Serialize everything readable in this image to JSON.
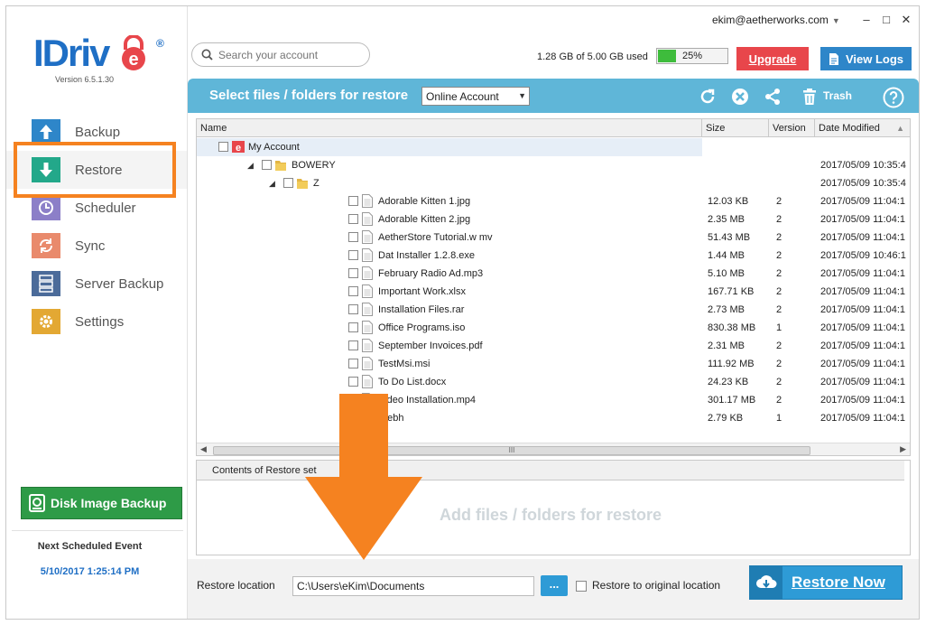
{
  "app": {
    "logo_text": "IDriv",
    "logo_mark": "e",
    "logo_reg": "®",
    "version": "Version  6.5.1.30"
  },
  "titlebar": {
    "account": "ekim@aetherworks.com",
    "minimize": "–",
    "maximize": "□",
    "close": "✕"
  },
  "search": {
    "placeholder": "Search your account"
  },
  "storage": {
    "usage_text": "1.28 GB of 5.00 GB used",
    "percent_text": "25%",
    "percent": 25
  },
  "header_buttons": {
    "upgrade": "Upgrade",
    "view_logs": "View Logs"
  },
  "sidebar": {
    "items": [
      {
        "label": "Backup",
        "color": "#2e86c9"
      },
      {
        "label": "Restore",
        "color": "#23a88a"
      },
      {
        "label": "Scheduler",
        "color": "#8c7fc8"
      },
      {
        "label": "Sync",
        "color": "#e98a6c"
      },
      {
        "label": "Server Backup",
        "color": "#4b6b9a"
      },
      {
        "label": "Settings",
        "color": "#e3a833"
      }
    ],
    "disk_image_backup": "Disk Image Backup",
    "next_event_title": "Next Scheduled Event",
    "next_event_time": "5/10/2017 1:25:14 PM"
  },
  "restore_bar": {
    "title": "Select files / folders for restore",
    "source_selected": "Online Account",
    "trash_label": "Trash"
  },
  "table": {
    "columns": [
      "Name",
      "Size",
      "Version",
      "Date Modified"
    ],
    "rows": [
      {
        "name": "My Account",
        "size": "",
        "version": "",
        "date": "",
        "level": 0,
        "type": "account"
      },
      {
        "name": "BOWERY",
        "size": "",
        "version": "",
        "date": "2017/05/09 10:35:4",
        "level": 1,
        "type": "folder"
      },
      {
        "name": "Z",
        "size": "",
        "version": "",
        "date": "2017/05/09 10:35:4",
        "level": 2,
        "type": "folder"
      },
      {
        "name": "Adorable Kitten 1.jpg",
        "size": "12.03 KB",
        "version": "2",
        "date": "2017/05/09 11:04:1",
        "level": 3,
        "type": "file"
      },
      {
        "name": "Adorable Kitten 2.jpg",
        "size": "2.35 MB",
        "version": "2",
        "date": "2017/05/09 11:04:1",
        "level": 3,
        "type": "file"
      },
      {
        "name": "AetherStore Tutorial.w mv",
        "size": "51.43 MB",
        "version": "2",
        "date": "2017/05/09 11:04:1",
        "level": 3,
        "type": "file"
      },
      {
        "name": "Dat Installer 1.2.8.exe",
        "size": "1.44 MB",
        "version": "2",
        "date": "2017/05/09 10:46:1",
        "level": 3,
        "type": "file"
      },
      {
        "name": "February Radio Ad.mp3",
        "size": "5.10 MB",
        "version": "2",
        "date": "2017/05/09 11:04:1",
        "level": 3,
        "type": "file"
      },
      {
        "name": "Important Work.xlsx",
        "size": "167.71 KB",
        "version": "2",
        "date": "2017/05/09 11:04:1",
        "level": 3,
        "type": "file"
      },
      {
        "name": "Installation Files.rar",
        "size": "2.73 MB",
        "version": "2",
        "date": "2017/05/09 11:04:1",
        "level": 3,
        "type": "file"
      },
      {
        "name": "Office Programs.iso",
        "size": "830.38 MB",
        "version": "1",
        "date": "2017/05/09 11:04:1",
        "level": 3,
        "type": "file"
      },
      {
        "name": "September Invoices.pdf",
        "size": "2.31 MB",
        "version": "2",
        "date": "2017/05/09 11:04:1",
        "level": 3,
        "type": "file"
      },
      {
        "name": "TestMsi.msi",
        "size": "111.92 MB",
        "version": "2",
        "date": "2017/05/09 11:04:1",
        "level": 3,
        "type": "file"
      },
      {
        "name": "To Do List.docx",
        "size": "24.23 KB",
        "version": "2",
        "date": "2017/05/09 11:04:1",
        "level": 3,
        "type": "file"
      },
      {
        "name": "Video Installation.mp4",
        "size": "301.17 MB",
        "version": "2",
        "date": "2017/05/09 11:04:1",
        "level": 3,
        "type": "file"
      },
      {
        "name": "Webh",
        "size": "2.79 KB",
        "version": "1",
        "date": "2017/05/09 11:04:1",
        "level": 3,
        "type": "file"
      }
    ]
  },
  "restore_set": {
    "header": "Contents of Restore set",
    "empty_text": "Add files / folders for restore"
  },
  "bottom": {
    "location_label": "Restore location",
    "location_value": "C:\\Users\\eKim\\Documents",
    "browse": "...",
    "original_label": "Restore to original location",
    "restore_now": "Restore Now"
  },
  "colors": {
    "accent_blue": "#2e86c9",
    "bar_blue": "#5fb6d8",
    "highlight_orange": "#f58220",
    "green": "#2e9b47",
    "red": "#e8464b"
  }
}
